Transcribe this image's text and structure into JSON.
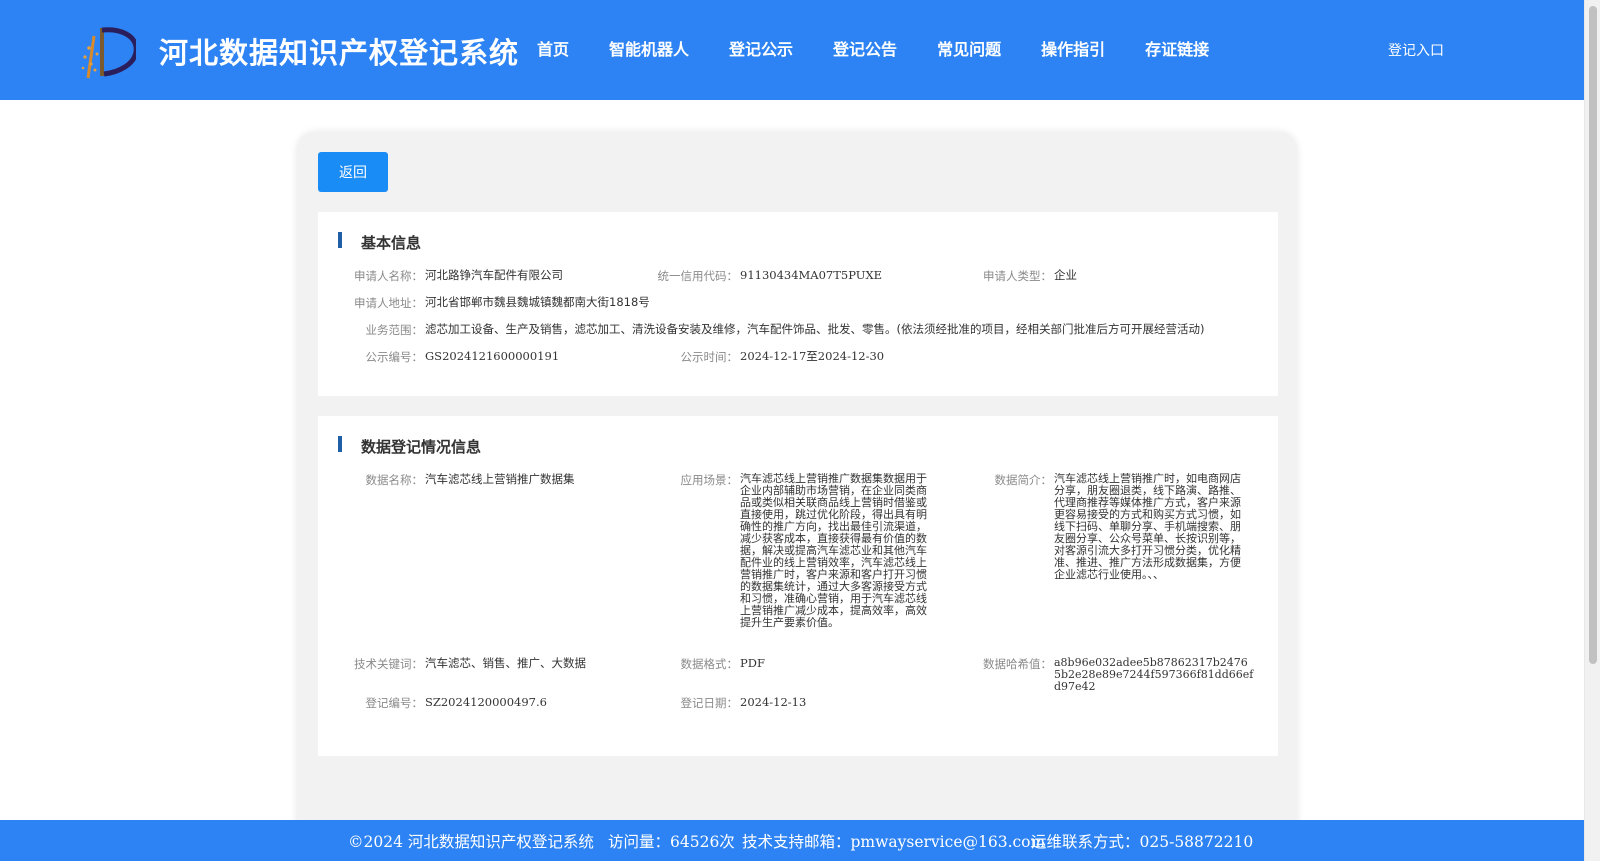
{
  "header": {
    "title": "河北数据知识产权登记系统",
    "nav": [
      "首页",
      "智能机器人",
      "登记公示",
      "登记公告",
      "常见问题",
      "操作指引",
      "存证链接"
    ],
    "login": "登记入口",
    "bg_color": "#2d83f3"
  },
  "back_label": "返回",
  "basic": {
    "title": "基本信息",
    "applicant_name_label": "申请人名称：",
    "applicant_name": "河北路铮汽车配件有限公司",
    "credit_code_label": "统一信用代码：",
    "credit_code": "91130434MA07T5PUXE",
    "applicant_type_label": "申请人类型：",
    "applicant_type": "企业",
    "address_label": "申请人地址：",
    "address": "河北省邯郸市魏县魏城镇魏都南大街1818号",
    "scope_label": "业务范围：",
    "scope": "滤芯加工设备、生产及销售，滤芯加工、清洗设备安装及维修，汽车配件饰品、批发、零售。(依法须经批准的项目，经相关部门批准后方可开展经营活动)",
    "notice_no_label": "公示编号：",
    "notice_no": "GS2024121600000191",
    "notice_time_label": "公示时间：",
    "notice_time": "2024-12-17至2024-12-30"
  },
  "registration": {
    "title": "数据登记情况信息",
    "data_name_label": "数据名称：",
    "data_name": "汽车滤芯线上营销推广数据集",
    "scenario_label": "应用场景：",
    "scenario": "汽车滤芯线上营销推广数据集数据用于企业内部辅助市场营销，在企业同类商品或类似相关联商品线上营销时借鉴或直接使用，跳过优化阶段，得出具有明确性的推广方向，找出最佳引流渠道，减少获客成本，直接获得最有价值的数据，解决或提高汽车滤芯业和其他汽车配件业的线上营销效率，汽车滤芯线上营销推广时，客户来源和客户打开习惯的数据集统计，通过大多客源接受方式和习惯，准确心营销，用于汽车滤芯线上营销推广减少成本，提高效率，高效提升生产要素价值。",
    "intro_label": "数据简介：",
    "intro": "汽车滤芯线上营销推广时，如电商网店分享，朋友圈退类，线下路演、路推、代理商推荐等媒体推广方式，客户来源更容易接受的方式和购买方式习惯，如线下扫码、单聊分享、手机端搜索、朋友圈分享、公众号菜单、长按识别等，对客源引流大多打开习惯分类，优化精准、推进、推广方法形成数据集，方便企业滤芯行业使用。、、",
    "keywords_label": "技术关键词：",
    "keywords": "汽车滤芯、销售、推广、大数据",
    "format_label": "数据格式：",
    "format": "PDF",
    "hash_label": "数据哈希值：",
    "hash": "a8b96e032adee5b87862317b24765b2e28e89e7244f597366f81dd66efd97e42",
    "reg_no_label": "登记编号：",
    "reg_no": "SZ2024120000497.6",
    "reg_date_label": "登记日期：",
    "reg_date": "2024-12-13"
  },
  "footer": {
    "copyright": "©2024 河北数据知识产权登记系统",
    "visits": "访问量：64526次",
    "email": "技术支持邮箱：pmwayservice@163.com",
    "contact": "运维联系方式：025-58872210"
  }
}
